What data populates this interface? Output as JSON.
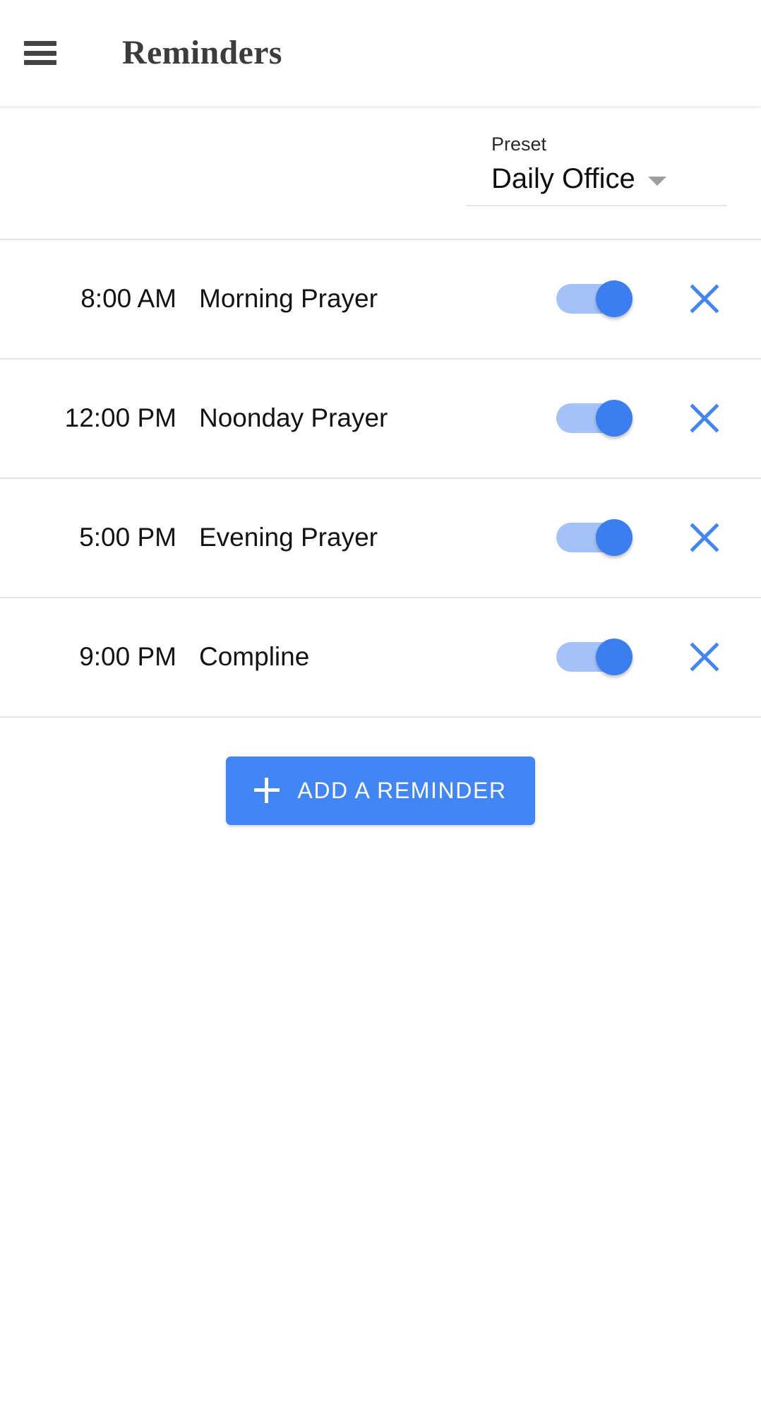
{
  "appbar": {
    "menu_icon": "hamburger-menu-icon",
    "title": "Reminders"
  },
  "preset": {
    "label": "Preset",
    "value": "Daily Office",
    "caret_icon": "chevron-down-icon"
  },
  "reminders": [
    {
      "time": "8:00 AM",
      "title": "Morning Prayer",
      "enabled": true,
      "delete_icon": "close-x-icon"
    },
    {
      "time": "12:00 PM",
      "title": "Noonday Prayer",
      "enabled": true,
      "delete_icon": "close-x-icon"
    },
    {
      "time": "5:00 PM",
      "title": "Evening Prayer",
      "enabled": true,
      "delete_icon": "close-x-icon"
    },
    {
      "time": "9:00 PM",
      "title": "Compline",
      "enabled": true,
      "delete_icon": "close-x-icon"
    }
  ],
  "add_button": {
    "label": "ADD A REMINDER",
    "icon": "plus-icon"
  },
  "colors": {
    "accent": "#4285f4",
    "toggle_track": "#a4c2f7",
    "toggle_thumb": "#3b7ef0",
    "divider": "#e4e4e4",
    "title_text": "#3c3c3c",
    "body_text": "#131313"
  }
}
